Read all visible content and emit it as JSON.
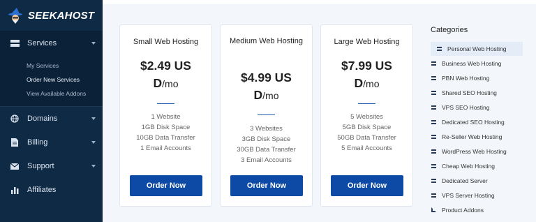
{
  "brand": {
    "logo_text": "SEEKAHOST"
  },
  "sidebar": {
    "services_label": "Services",
    "subitems": [
      "My Services",
      "Order New Services",
      "View Available Addons"
    ],
    "domains_label": "Domains",
    "billing_label": "Billing",
    "support_label": "Support",
    "affiliates_label": "Affiliates"
  },
  "plans": [
    {
      "title": "Small Web Hosting",
      "price": "$2.49 US",
      "price_cont": "D",
      "per": "/mo",
      "features": [
        "1 Website",
        "1GB Disk Space",
        "10GB Data Transfer",
        "1 Email Accounts"
      ],
      "button": "Order Now"
    },
    {
      "title": "Medium Web Hosting",
      "price": "$4.99 US",
      "price_cont": "D",
      "per": "/mo",
      "features": [
        "3 Websites",
        "3GB Disk Space",
        "30GB Data Transfer",
        "3 Email Accounts"
      ],
      "button": "Order Now"
    },
    {
      "title": "Large Web Hosting",
      "price": "$7.99 US",
      "price_cont": "D",
      "per": "/mo",
      "features": [
        "5 Websites",
        "5GB Disk Space",
        "50GB Data Transfer",
        "5 Email Accounts"
      ],
      "button": "Order Now"
    }
  ],
  "categories": {
    "heading": "Categories",
    "items": [
      "Personal Web Hosting",
      "Business Web Hosting",
      "PBN Web Hosting",
      "Shared SEO Hosting",
      "VPS SEO Hosting",
      "Dedicated SEO Hosting",
      "Re-Seller Web Hosting",
      "WordPress Web Hosting",
      "Cheap Web Hosting",
      "Dedicated Server",
      "VPS Server Hosting",
      "Product Addons"
    ]
  },
  "colors": {
    "sidebar_bg": "#0f2a45",
    "accent": "#0d4aa6",
    "category_active_bg": "#e3ecf7"
  }
}
